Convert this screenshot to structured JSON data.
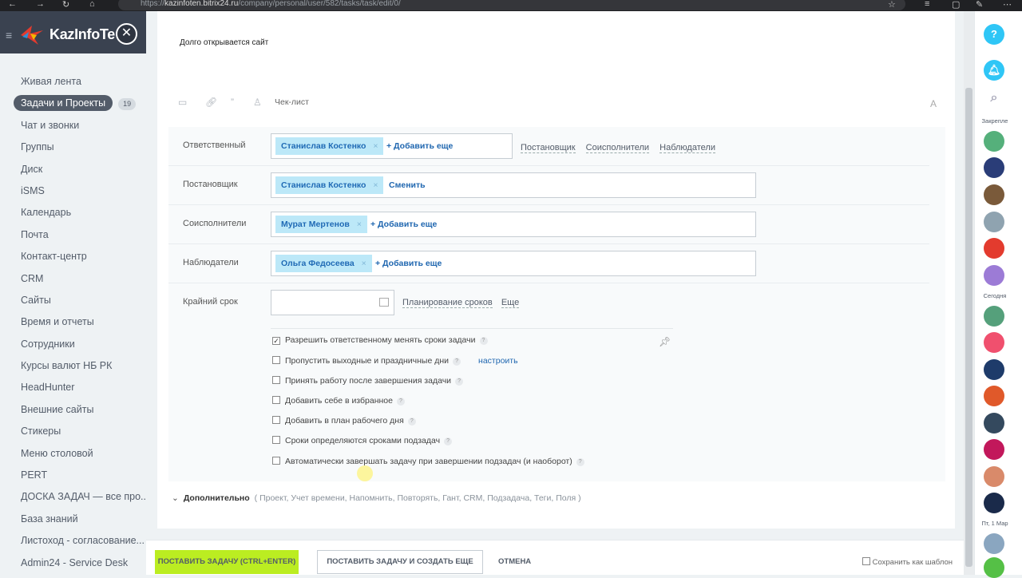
{
  "browser": {
    "url_prefix": "https://",
    "url_host": "kazinfoten.bitrix24.ru",
    "url_path": "/company/personal/user/582/tasks/task/edit/0/"
  },
  "sidebar": {
    "logo": "KazInfoTe",
    "items": [
      {
        "label": "Живая лента"
      },
      {
        "label": "Задачи и Проекты",
        "count": "19",
        "active": true
      },
      {
        "label": "Чат и звонки"
      },
      {
        "label": "Группы"
      },
      {
        "label": "Диск"
      },
      {
        "label": "iSMS"
      },
      {
        "label": "Календарь"
      },
      {
        "label": "Почта"
      },
      {
        "label": "Контакт-центр"
      },
      {
        "label": "CRM"
      },
      {
        "label": "Сайты"
      },
      {
        "label": "Время и отчеты"
      },
      {
        "label": "Сотрудники"
      },
      {
        "label": "Курсы валют НБ РК"
      },
      {
        "label": "HeadHunter"
      },
      {
        "label": "Внешние сайты"
      },
      {
        "label": "Стикеры"
      },
      {
        "label": "Меню столовой"
      },
      {
        "label": "PERT"
      },
      {
        "label": "ДОСКА ЗАДАЧ — все про..."
      },
      {
        "label": "База знаний"
      },
      {
        "label": "Листоход - согласование..."
      },
      {
        "label": "Admin24 - Service Desk"
      }
    ]
  },
  "task": {
    "description": "Долго открывается сайт",
    "checklist_label": "Чек-лист",
    "format_icon": "A"
  },
  "form": {
    "responsible": {
      "label": "Ответственный",
      "person": "Станислав Костенко",
      "add": "+ Добавить еще"
    },
    "role_links": [
      "Постановщик",
      "Соисполнители",
      "Наблюдатели"
    ],
    "creator": {
      "label": "Постановщик",
      "person": "Станислав Костенко",
      "change": "Сменить"
    },
    "coexec": {
      "label": "Соисполнители",
      "person": "Мурат Мертенов",
      "add": "+ Добавить еще"
    },
    "observers": {
      "label": "Наблюдатели",
      "person": "Ольга Федосеева",
      "add": "+ Добавить еще"
    },
    "deadline": {
      "label": "Крайний срок",
      "planning": "Планирование сроков",
      "more": "Еще"
    },
    "options": [
      {
        "label": "Разрешить ответственному менять сроки задачи",
        "checked": true
      },
      {
        "label": "Пропустить выходные и праздничные дни",
        "checked": false,
        "link": "настроить"
      },
      {
        "label": "Принять работу после завершения задачи",
        "checked": false
      },
      {
        "label": "Добавить себе в избранное",
        "checked": false
      },
      {
        "label": "Добавить в план рабочего дня",
        "checked": false
      },
      {
        "label": "Сроки определяются сроками подзадач",
        "checked": false
      },
      {
        "label": "Автоматически завершать задачу при завершении подзадач (и наоборот)",
        "checked": false
      }
    ],
    "help": "?"
  },
  "extra": {
    "title": "Дополнительно",
    "items": "( Проект,  Учет времени,  Напомнить,  Повторять,  Гант,  CRM,  Подзадача,  Теги,  Поля )"
  },
  "footer": {
    "submit": "ПОСТАВИТЬ ЗАДАЧУ (CTRL+ENTER)",
    "submit_more": "ПОСТАВИТЬ ЗАДАЧУ И СОЗДАТЬ ЕЩЕ",
    "cancel": "ОТМЕНА",
    "save_template": "Сохранить как шаблон"
  },
  "right_panel": {
    "help": "?",
    "pinned_label": "Закрепле",
    "today_label": "Сегодня",
    "date_label": "Пт, 1 Мар"
  },
  "colors": {
    "accent_green": "#bbed21",
    "tag_bg": "#bce8f8",
    "link_blue": "#2067b0",
    "sidebar_dark": "#3a4250",
    "help_blue": "#2fc6f6"
  }
}
